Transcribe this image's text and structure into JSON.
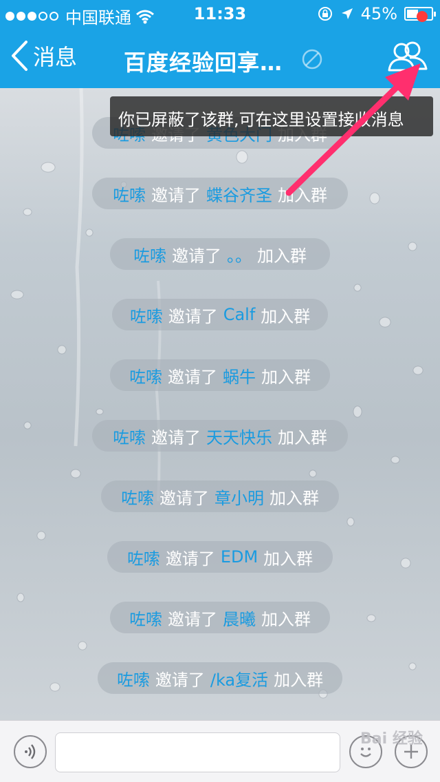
{
  "status": {
    "carrier": "中国联通",
    "time": "11:33",
    "battery": "45%"
  },
  "nav": {
    "back_label": "消息",
    "title": "百度经验回享…"
  },
  "tooltip": "你已屏蔽了该群,可在这里设置接收消息",
  "messages": [
    {
      "inviter": "咗嗦",
      "verb": "邀请了",
      "invitee": "黄色大门",
      "suffix": "加入群"
    },
    {
      "inviter": "咗嗦",
      "verb": "邀请了",
      "invitee": "蝶谷齐圣",
      "suffix": "加入群"
    },
    {
      "inviter": "咗嗦",
      "verb": "邀请了",
      "invitee": "。。",
      "suffix": "加入群"
    },
    {
      "inviter": "咗嗦",
      "verb": "邀请了",
      "invitee": "Calf",
      "suffix": "加入群"
    },
    {
      "inviter": "咗嗦",
      "verb": "邀请了",
      "invitee": "蜗牛",
      "suffix": "加入群"
    },
    {
      "inviter": "咗嗦",
      "verb": "邀请了",
      "invitee": "天天快乐",
      "suffix": "加入群"
    },
    {
      "inviter": "咗嗦",
      "verb": "邀请了",
      "invitee": "章小明",
      "suffix": "加入群"
    },
    {
      "inviter": "咗嗦",
      "verb": "邀请了",
      "invitee": "EDM",
      "suffix": "加入群"
    },
    {
      "inviter": "咗嗦",
      "verb": "邀请了",
      "invitee": "晨曦",
      "suffix": "加入群"
    },
    {
      "inviter": "咗嗦",
      "verb": "邀请了",
      "invitee": "/ka复活",
      "suffix": "加入群"
    }
  ],
  "input": {
    "value": "",
    "placeholder": ""
  },
  "watermark": "Bai 经验",
  "colors": {
    "nav_blue": "#1aa3e6",
    "name_blue": "#1a9be0",
    "badge_red": "#ff3b3b",
    "arrow_pink": "#ff2f6e"
  },
  "icons": {
    "back": "chevron-left-icon",
    "mute": "mute-icon",
    "group": "group-members-icon",
    "voice": "voice-icon",
    "emoji": "emoji-icon",
    "plus": "plus-icon"
  }
}
